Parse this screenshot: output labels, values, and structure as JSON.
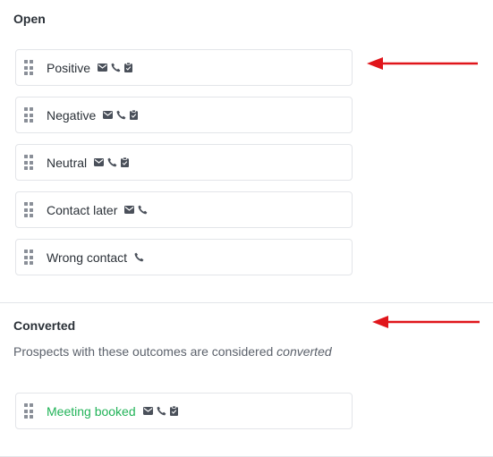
{
  "sections": {
    "open": {
      "title": "Open",
      "outcomes": [
        {
          "label": "Positive",
          "icons": [
            "mail-icon",
            "phone-icon",
            "clipboard-icon"
          ]
        },
        {
          "label": "Negative",
          "icons": [
            "mail-icon",
            "phone-icon",
            "clipboard-icon"
          ]
        },
        {
          "label": "Neutral",
          "icons": [
            "mail-icon",
            "phone-icon",
            "clipboard-icon"
          ]
        },
        {
          "label": "Contact later",
          "icons": [
            "mail-icon",
            "phone-icon"
          ]
        },
        {
          "label": "Wrong contact",
          "icons": [
            "phone-icon"
          ]
        }
      ]
    },
    "converted": {
      "title": "Converted",
      "description_prefix": "Prospects with these outcomes are considered ",
      "description_emphasis": "converted",
      "outcomes": [
        {
          "label": "Meeting booked",
          "icons": [
            "mail-icon",
            "phone-icon",
            "clipboard-icon"
          ]
        }
      ]
    }
  },
  "colors": {
    "text": "#2b3138",
    "muted": "#5b616b",
    "success": "#21b358",
    "border": "#e3e5e9",
    "annotation_arrow": "#e0151b"
  }
}
